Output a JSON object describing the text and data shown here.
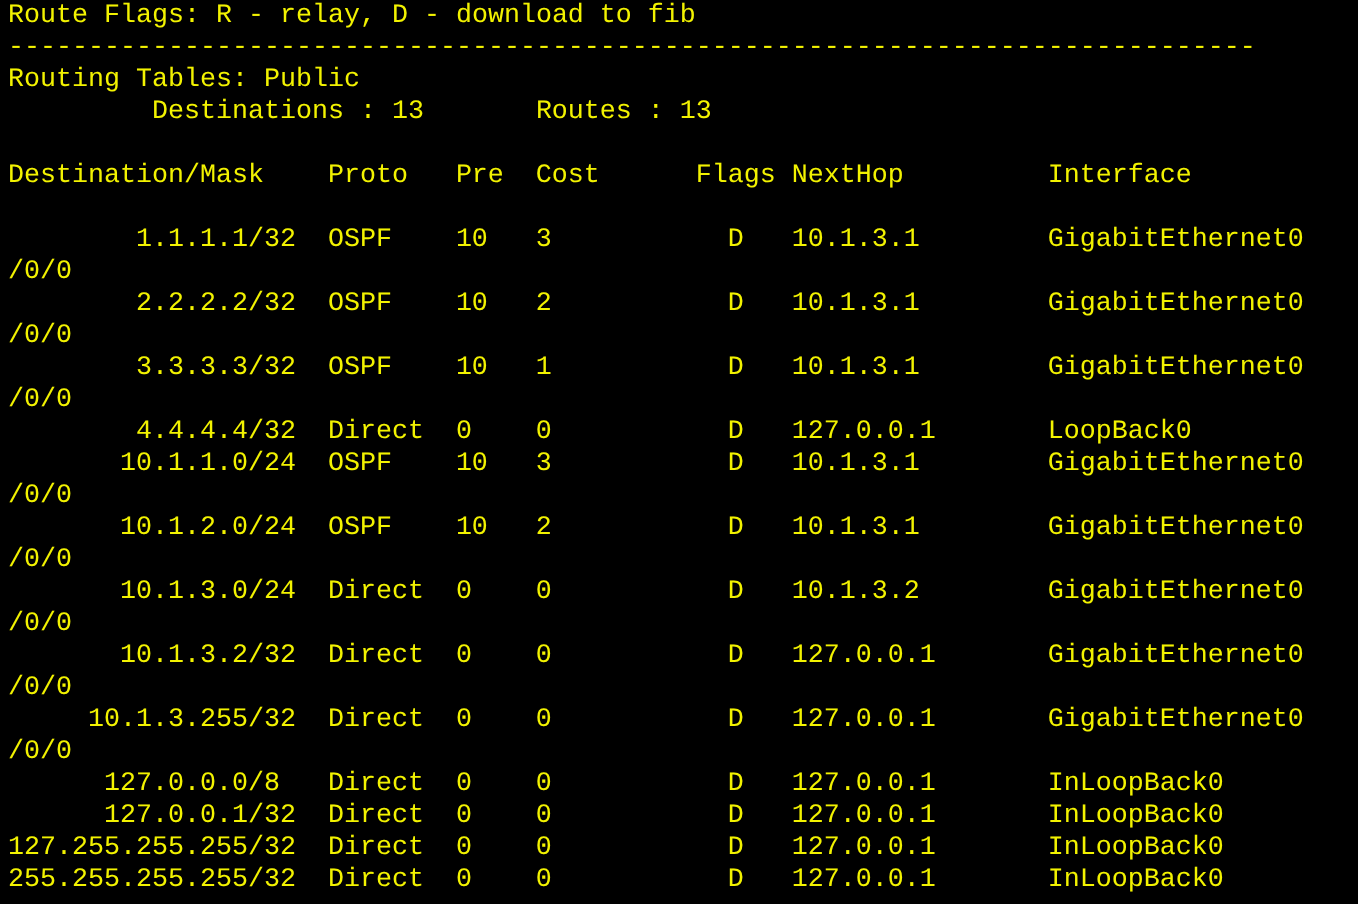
{
  "route_flags": "Route Flags: R - relay, D - download to fib",
  "separator": "------------------------------------------------------------------------------",
  "routing_tables": "Routing Tables: Public",
  "summary": {
    "destinations": "Destinations : 13",
    "routes": "Routes : 13"
  },
  "table": {
    "columns": [
      "Destination/Mask",
      "Proto",
      "Pre",
      "Cost",
      "Flags",
      "NextHop",
      "Interface"
    ],
    "rows": [
      {
        "destination": "1.1.1.1/32",
        "proto": "OSPF",
        "pre": "10",
        "cost": "3",
        "flags": "D",
        "nexthop": "10.1.3.1",
        "interface": "GigabitEthernet0",
        "continuation": "/0/0"
      },
      {
        "destination": "2.2.2.2/32",
        "proto": "OSPF",
        "pre": "10",
        "cost": "2",
        "flags": "D",
        "nexthop": "10.1.3.1",
        "interface": "GigabitEthernet0",
        "continuation": "/0/0"
      },
      {
        "destination": "3.3.3.3/32",
        "proto": "OSPF",
        "pre": "10",
        "cost": "1",
        "flags": "D",
        "nexthop": "10.1.3.1",
        "interface": "GigabitEthernet0",
        "continuation": "/0/0"
      },
      {
        "destination": "4.4.4.4/32",
        "proto": "Direct",
        "pre": "0",
        "cost": "0",
        "flags": "D",
        "nexthop": "127.0.0.1",
        "interface": "LoopBack0"
      },
      {
        "destination": "10.1.1.0/24",
        "proto": "OSPF",
        "pre": "10",
        "cost": "3",
        "flags": "D",
        "nexthop": "10.1.3.1",
        "interface": "GigabitEthernet0",
        "continuation": "/0/0"
      },
      {
        "destination": "10.1.2.0/24",
        "proto": "OSPF",
        "pre": "10",
        "cost": "2",
        "flags": "D",
        "nexthop": "10.1.3.1",
        "interface": "GigabitEthernet0",
        "continuation": "/0/0"
      },
      {
        "destination": "10.1.3.0/24",
        "proto": "Direct",
        "pre": "0",
        "cost": "0",
        "flags": "D",
        "nexthop": "10.1.3.2",
        "interface": "GigabitEthernet0",
        "continuation": "/0/0"
      },
      {
        "destination": "10.1.3.2/32",
        "proto": "Direct",
        "pre": "0",
        "cost": "0",
        "flags": "D",
        "nexthop": "127.0.0.1",
        "interface": "GigabitEthernet0",
        "continuation": "/0/0"
      },
      {
        "destination": "10.1.3.255/32",
        "proto": "Direct",
        "pre": "0",
        "cost": "0",
        "flags": "D",
        "nexthop": "127.0.0.1",
        "interface": "GigabitEthernet0",
        "continuation": "/0/0"
      },
      {
        "destination": "127.0.0.0/8",
        "proto": "Direct",
        "pre": "0",
        "cost": "0",
        "flags": "D",
        "nexthop": "127.0.0.1",
        "interface": "InLoopBack0"
      },
      {
        "destination": "127.0.0.1/32",
        "proto": "Direct",
        "pre": "0",
        "cost": "0",
        "flags": "D",
        "nexthop": "127.0.0.1",
        "interface": "InLoopBack0"
      },
      {
        "destination": "127.255.255.255/32",
        "proto": "Direct",
        "pre": "0",
        "cost": "0",
        "flags": "D",
        "nexthop": "127.0.0.1",
        "interface": "InLoopBack0"
      },
      {
        "destination": "255.255.255.255/32",
        "proto": "Direct",
        "pre": "0",
        "cost": "0",
        "flags": "D",
        "nexthop": "127.0.0.1",
        "interface": "InLoopBack0"
      }
    ]
  }
}
